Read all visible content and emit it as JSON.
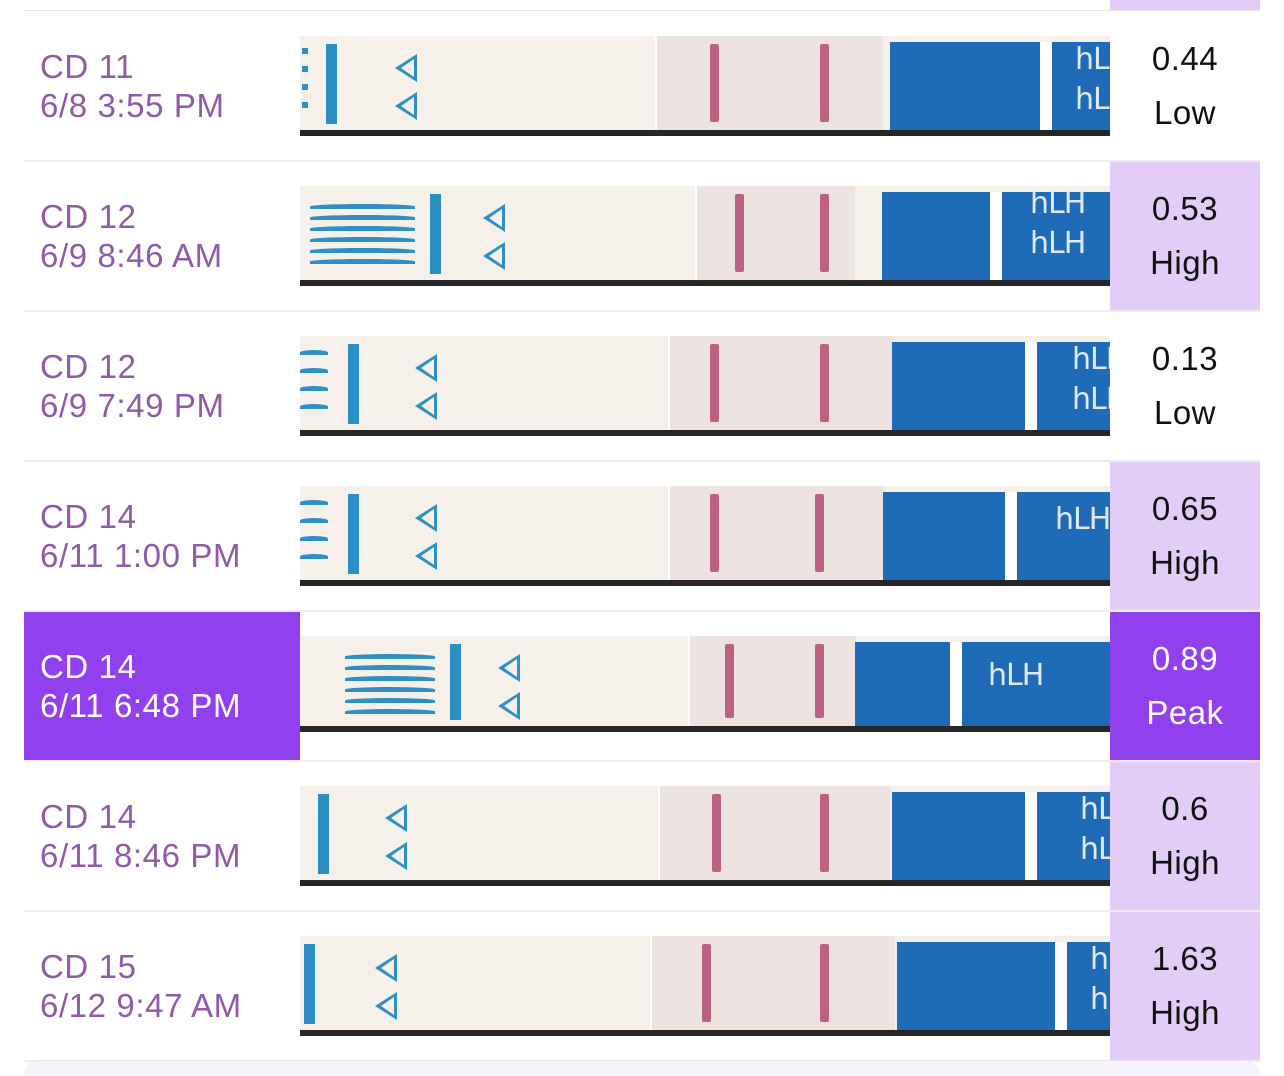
{
  "colors": {
    "label_text": "#8f5aa8",
    "selected_bg": "#9140ee",
    "high_bg": "#e3ccf6",
    "test_line": "#b24a70",
    "strip_blue": "#1f6bb8"
  },
  "rows": [
    {
      "cd": "CD 11",
      "datetime": "6/8 3:55 PM",
      "value": "0.44",
      "level": "Low",
      "status": "low",
      "selected": false
    },
    {
      "cd": "CD 12",
      "datetime": "6/9 8:46 AM",
      "value": "0.53",
      "level": "High",
      "status": "high",
      "selected": false
    },
    {
      "cd": "CD 12",
      "datetime": "6/9 7:49 PM",
      "value": "0.13",
      "level": "Low",
      "status": "low",
      "selected": false
    },
    {
      "cd": "CD 14",
      "datetime": "6/11 1:00 PM",
      "value": "0.65",
      "level": "High",
      "status": "high",
      "selected": false
    },
    {
      "cd": "CD 14",
      "datetime": "6/11 6:48 PM",
      "value": "0.89",
      "level": "Peak",
      "status": "peak",
      "selected": true
    },
    {
      "cd": "CD 14",
      "datetime": "6/11 8:46 PM",
      "value": "0.6",
      "level": "High",
      "status": "high",
      "selected": false
    },
    {
      "cd": "CD 15",
      "datetime": "6/12 9:47 AM",
      "value": "1.63",
      "level": "High",
      "status": "high",
      "selected": false
    }
  ],
  "strip_text": "hLH"
}
